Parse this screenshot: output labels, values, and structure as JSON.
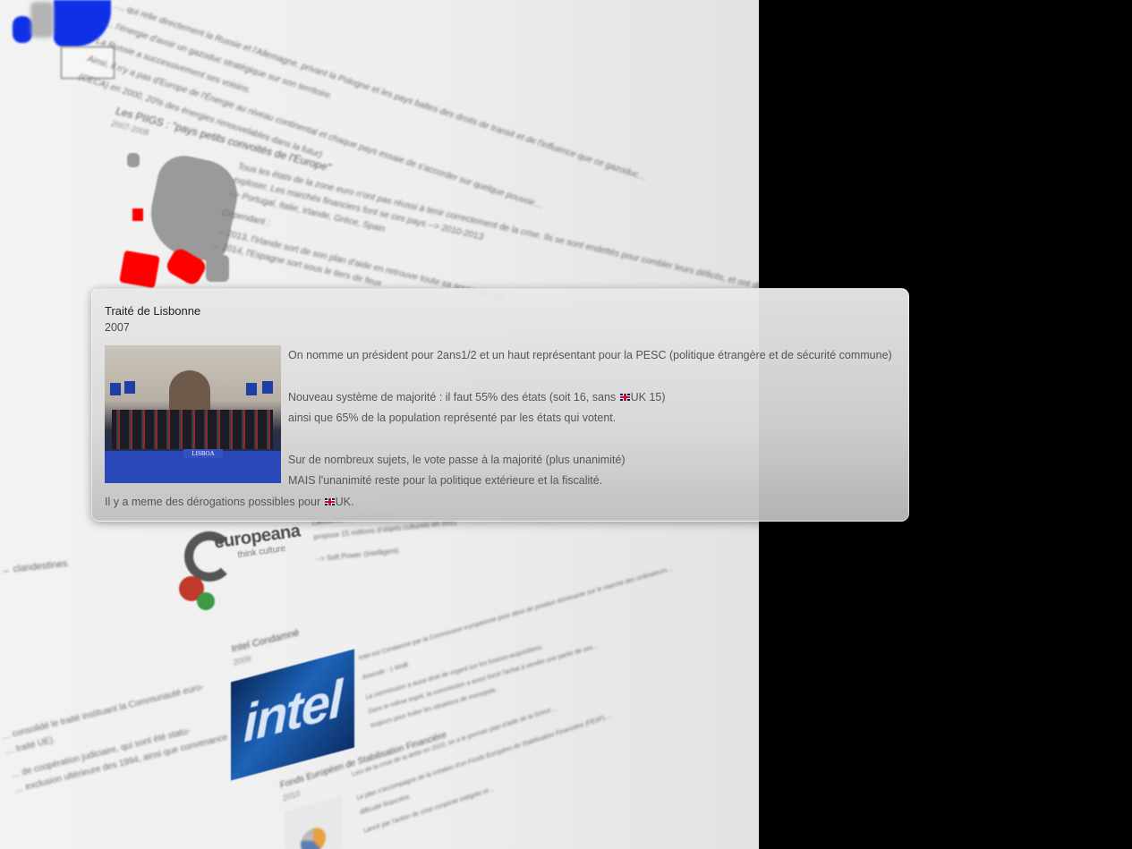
{
  "colors": {
    "black_pane": "#000000",
    "card_title": "#202020",
    "card_text": "#555555",
    "map_red": "#ff0000",
    "map_blue": "#1030e8"
  },
  "background_blurred": {
    "top_lines": [
      "…, qui relie directement la Russie et l'Allemagne, privant la Pologne et les pays baltes des droits de transit et de l'influence que ce gazoduc…",
      "… l'énergie d'avoir un gazoduc stratégique sur son territoire.",
      "La Russie a successivement ses voisins.",
      "Ainsi, il n'y a pas d'Europe de l'Énergie au niveau continental et chaque pays essaie de s'accorder sur quelque pouvoir…",
      "(CECA) en 2000, 20% des énergies renouvelables dans la futur)"
    ],
    "piigs": {
      "title": "Les PIIGS : \"pays petits convoités de l'Europe\"",
      "years": "2007-2008",
      "lines": [
        "Tous les états de la zone euro n'ont pas réussi à tenir correctement de la crise. Ils se sont endettés pour combler leurs déficits, et ont dû mettre…",
        "exploser. Les marchés financiers font se ces pays --> 2010-2013",
        "--> Portugal, Italie, Irlande, Grèce, Spain",
        "Cependant :",
        "→ 2013, l'Irlande sort de son plan d'aide en retrouve toute sa souveraineté",
        "→ 2014, l'Espagne sort sous le tiers de feux"
      ]
    },
    "europeana": {
      "logo_text": "europeana",
      "logo_sub": "think culture",
      "lines": [
        "Lancement de Europeana, …",
        "propose 15 millions d'objets culturels en 2011",
        "--> Soft Power (Intelligent)"
      ]
    },
    "intel": {
      "title": "Intel Condamné",
      "year": "2009",
      "logo_text": "intel",
      "lines": [
        "Intel est Condamné par la Commission européenne pour abus de position dominante sur le marché des ordinateurs…",
        "Amende : 1 Mrd€",
        "La commission a aussi droit de regard sur les fusions-acquisitions.",
        "Dans le même esprit, la commission a aussi forcé l'achat à vendre une partie de ses…",
        "toujours pour éviter les situations de monopole."
      ]
    },
    "fesf": {
      "title": "Fonds Européen de Stabilisation Financière",
      "year": "2010",
      "lines": [
        "Lors de la crise de la dette en 2010, on a le premier plan d'aide de la Grèce…",
        "Le plan s'accompagne de la création d'un Fonds Européen de Stabilisation Financière (FESF)…",
        "difficulté financière.",
        "Lancé par l'action de crise conjointe intégrée et…"
      ]
    },
    "left_lines": [
      "→ clandestines",
      "… consolidé le traité instituant la Communauté euro-",
      "… traité UE).",
      "… de coopération judiciaire, qui sont été statu-",
      "… exclusion ultérieure des 1994, ainsi que convenance"
    ]
  },
  "card": {
    "title": "Traité de Lisbonne",
    "year": "2007",
    "photo_sign": "LISBOA",
    "lines": [
      "On nomme un président pour 2ans1/2 et un haut représentant pour la PESC (politique étrangère et de sécurité commune)",
      "Nouveau système de majorité : il faut 55% des états (soit 16, sans",
      "UK 15)",
      "ainsi que 65% de la population représenté par les états qui votent.",
      "Sur de nombreux sujets, le vote passe à la majorité (plus unanimité)",
      "MAIS l'unanimité reste pour la politique extérieure et la fiscalité.",
      "Il y a meme des dérogations possibles pour",
      "UK."
    ],
    "flag_icon": "uk-flag-icon"
  }
}
